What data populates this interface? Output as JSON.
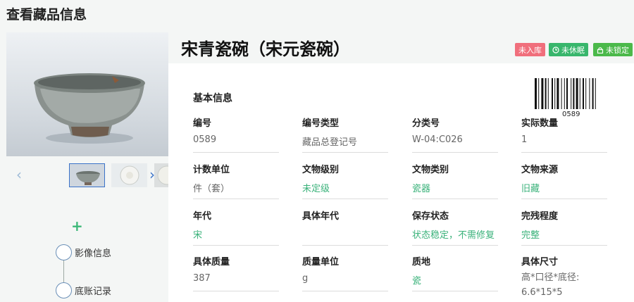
{
  "page": {
    "title": "查看藏品信息"
  },
  "object": {
    "title": "宋青瓷碗（宋元瓷碗）"
  },
  "badges": [
    {
      "label": "未入库",
      "color": "#f06f7c",
      "icon": ""
    },
    {
      "label": "未休眠",
      "color": "#38b66c",
      "icon": "clock-icon"
    },
    {
      "label": "未锁定",
      "color": "#4bb94a",
      "icon": "lock-icon"
    }
  ],
  "gallery": {
    "prev": "‹",
    "next": "›",
    "thumb_count": 3
  },
  "timeline": {
    "add_label": "+",
    "items": [
      {
        "label": "影像信息"
      },
      {
        "label": "底账记录"
      }
    ]
  },
  "basic_info": {
    "section_title": "基本信息",
    "barcode_number": "0589",
    "fields": [
      {
        "label": "编号",
        "value": "0589",
        "style": "gray"
      },
      {
        "label": "编号类型",
        "value": "藏品总登记号",
        "style": "gray"
      },
      {
        "label": "分类号",
        "value": "W-04:C026",
        "style": "gray"
      },
      {
        "label": "实际数量",
        "value": "1",
        "style": "gray"
      },
      {
        "label": "计数单位",
        "value": "件（套）",
        "style": "gray"
      },
      {
        "label": "文物级别",
        "value": "未定级",
        "style": "green"
      },
      {
        "label": "文物类别",
        "value": "瓷器",
        "style": "green"
      },
      {
        "label": "文物来源",
        "value": "旧藏",
        "style": "green"
      },
      {
        "label": "年代",
        "value": "宋",
        "style": "green"
      },
      {
        "label": "具体年代",
        "value": "",
        "style": "gray"
      },
      {
        "label": "保存状态",
        "value": "状态稳定，不需修复",
        "style": "green"
      },
      {
        "label": "完残程度",
        "value": "完整",
        "style": "green"
      },
      {
        "label": "具体质量",
        "value": "387",
        "style": "gray"
      },
      {
        "label": "质量单位",
        "value": "g",
        "style": "gray"
      },
      {
        "label": "质地",
        "value": "瓷",
        "style": "green"
      },
      {
        "label": "具体尺寸",
        "value": "高*口径*底径: 6.6*15*5",
        "style": "gray"
      }
    ]
  }
}
